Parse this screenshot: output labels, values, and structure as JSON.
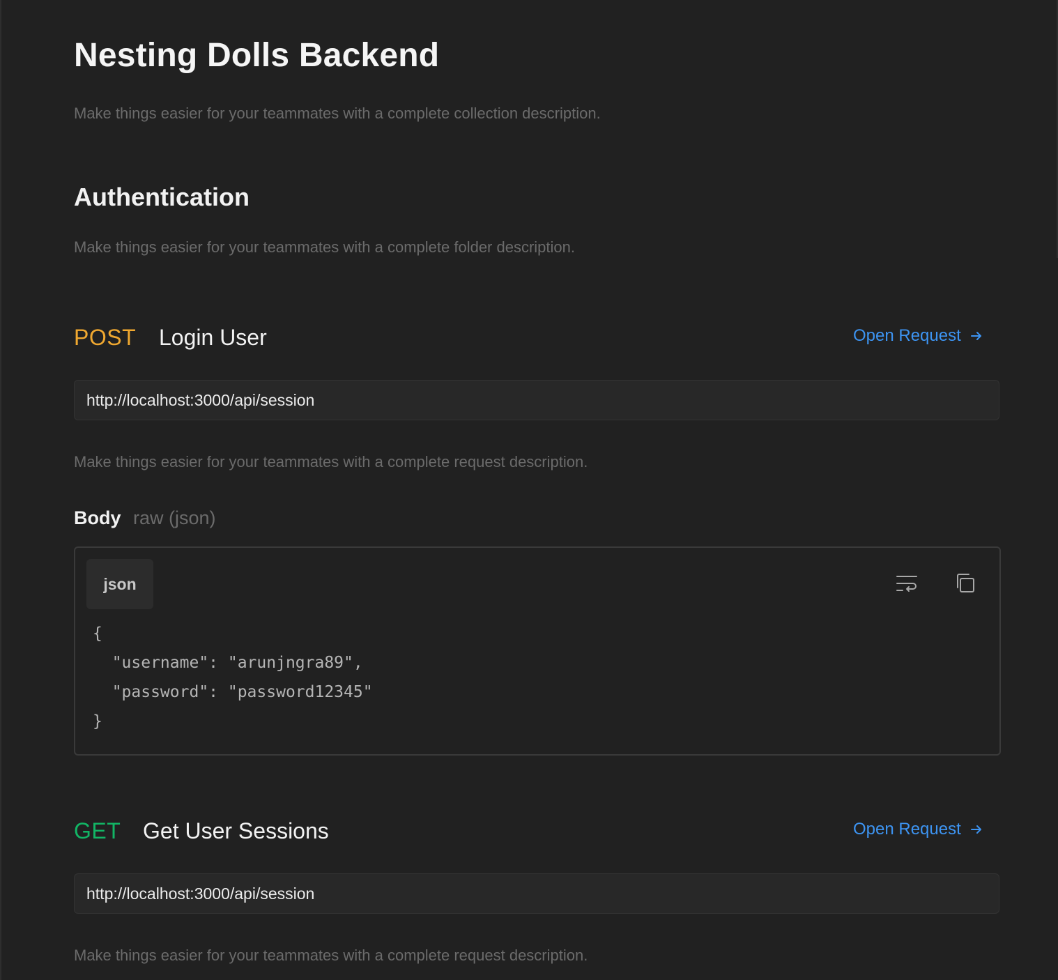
{
  "collection": {
    "title": "Nesting Dolls Backend",
    "description": "Make things easier for your teammates with a complete collection description."
  },
  "folder": {
    "title": "Authentication",
    "description": "Make things easier for your teammates with a complete folder description."
  },
  "requests": [
    {
      "method": "POST",
      "method_color": "#f0a830",
      "name": "Login User",
      "open_label": "Open Request",
      "url": "http://localhost:3000/api/session",
      "description": "Make things easier for your teammates with a complete request description.",
      "body": {
        "label": "Body",
        "type": "raw (json)",
        "language": "json",
        "lines": [
          "{",
          "  \"username\": \"arunjngra89\",",
          "  \"password\": \"password12345\"",
          "}"
        ]
      }
    },
    {
      "method": "GET",
      "method_color": "#12b565",
      "name": "Get User Sessions",
      "open_label": "Open Request",
      "url": "http://localhost:3000/api/session",
      "description": "Make things easier for your teammates with a complete request description."
    }
  ],
  "icons": {
    "open_request": "arrow-right-icon",
    "wrap": "wrap-lines-icon",
    "copy": "copy-icon"
  },
  "colors": {
    "background": "#212121",
    "link": "#3d94f2",
    "muted_text": "#6b6b6b"
  }
}
